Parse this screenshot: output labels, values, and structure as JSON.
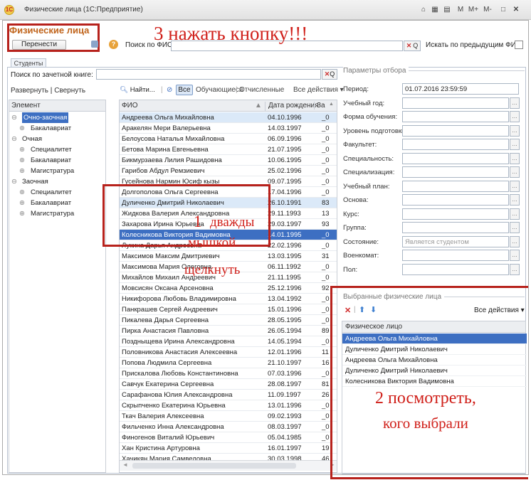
{
  "window": {
    "title": "Физические лица (1С:Предприятие)",
    "app_badge": "1С",
    "right_controls": [
      "M",
      "M+",
      "M-"
    ]
  },
  "form": {
    "title": "Физические лица",
    "move_button": "Перенести",
    "help": "?",
    "search_fio_label": "Поиск по ФИО:",
    "search_prev_label": "Искать по предыдущим ФИО:",
    "tab": "Студенты"
  },
  "left": {
    "search_label": "Поиск по зачетной книге:",
    "expand": "Развернуть",
    "sep": "|",
    "collapse": "Свернуть",
    "tree_header": "Элемент",
    "tree": [
      {
        "label": "Очно-заочная",
        "level": 0,
        "selected": true
      },
      {
        "label": "Бакалавриат",
        "level": 1
      },
      {
        "label": "Очная",
        "level": 0
      },
      {
        "label": "Специалитет",
        "level": 1
      },
      {
        "label": "Бакалавриат",
        "level": 1
      },
      {
        "label": "Магистратура",
        "level": 1
      },
      {
        "label": "Заочная",
        "level": 0
      },
      {
        "label": "Специалитет",
        "level": 1
      },
      {
        "label": "Бакалавриат",
        "level": 1
      },
      {
        "label": "Магистратура",
        "level": 1
      }
    ]
  },
  "list": {
    "find": "Найти...",
    "filter_all": "Все",
    "filter_students": "Обучающиеся",
    "filter_expelled": "Отчисленные",
    "all_actions": "Все действия",
    "col_fio": "ФИО",
    "col_birth": "Дата рождения",
    "col_extra": "За",
    "rows": [
      {
        "fio": "Андреева Ольга Михайловна",
        "date": "04.10.1996",
        "extra": "_0",
        "hl": true
      },
      {
        "fio": "Аракелян Мери Валерьевна",
        "date": "14.03.1997",
        "extra": "_0"
      },
      {
        "fio": "Белоусова Наталья Михайловна",
        "date": "06.09.1996",
        "extra": "_0"
      },
      {
        "fio": "Бетова Марина Евгеньевна",
        "date": "21.07.1995",
        "extra": "_0"
      },
      {
        "fio": "Бикмурзаева Лилия Рашидовна",
        "date": "10.06.1995",
        "extra": "_0"
      },
      {
        "fio": "Гарибов Абдул Ремзиевич",
        "date": "25.02.1996",
        "extra": "_0"
      },
      {
        "fio": "Гусейнова Нармин Юсиф кызы",
        "date": "09.07.1995",
        "extra": "_0"
      },
      {
        "fio": "Долгополова Ольга Сергеевна",
        "date": "17.04.1996",
        "extra": "_0"
      },
      {
        "fio": "Дуличенко Дмитрий Николаевич",
        "date": "26.10.1991",
        "extra": "83",
        "hl": true
      },
      {
        "fio": "Жидкова Валерия Александровна",
        "date": "29.11.1993",
        "extra": "13"
      },
      {
        "fio": "Захарова Ирина Юрьевна",
        "date": "29.03.1997",
        "extra": "93"
      },
      {
        "fio": "Колесникова Виктория Вадимовна",
        "date": "14.01.1995",
        "extra": "_0",
        "sel": true
      },
      {
        "fio": "Лукина Дарья Андреевна",
        "date": "22.02.1996",
        "extra": "_0"
      },
      {
        "fio": "Максимов Максим Дмитриевич",
        "date": "13.03.1995",
        "extra": "31"
      },
      {
        "fio": "Максимова Мария Олеговна",
        "date": "06.11.1992",
        "extra": "_0"
      },
      {
        "fio": "Михайлов Михаил Андреевич",
        "date": "21.11.1995",
        "extra": "_0"
      },
      {
        "fio": "Мовсисян Оксана Арсеновна",
        "date": "25.12.1996",
        "extra": "92"
      },
      {
        "fio": "Никифорова Любовь Владимировна",
        "date": "13.04.1992",
        "extra": "_0"
      },
      {
        "fio": "Панкрашев Сергей Андреевич",
        "date": "15.01.1996",
        "extra": "_0"
      },
      {
        "fio": "Пикалева Дарья Сергеевна",
        "date": "28.05.1995",
        "extra": "_0"
      },
      {
        "fio": "Пирка Анастасия Павловна",
        "date": "26.05.1994",
        "extra": "89"
      },
      {
        "fio": "Поздныщева Ирина Александровна",
        "date": "14.05.1994",
        "extra": "_0"
      },
      {
        "fio": "Половникова Анастасия Алексеевна",
        "date": "12.01.1996",
        "extra": "11"
      },
      {
        "fio": "Попова Людмила Сергеевна",
        "date": "21.10.1997",
        "extra": "16"
      },
      {
        "fio": "Прискалова Любовь Константиновна",
        "date": "07.03.1996",
        "extra": "_0"
      },
      {
        "fio": "Савчук Екатерина Сергеевна",
        "date": "28.08.1997",
        "extra": "81"
      },
      {
        "fio": "Сарафанова Юлия Александровна",
        "date": "11.09.1997",
        "extra": "26"
      },
      {
        "fio": "Скрыпченко Екатерина Юрьевна",
        "date": "13.01.1996",
        "extra": "_0"
      },
      {
        "fio": "Ткач Валерия Алексеевна",
        "date": "09.02.1993",
        "extra": "_0"
      },
      {
        "fio": "Фильченко Инна Александровна",
        "date": "08.03.1997",
        "extra": "_0"
      },
      {
        "fio": "Финогенов Виталий Юрьевич",
        "date": "05.04.1985",
        "extra": "_0"
      },
      {
        "fio": "Хан Кристина Артуровна",
        "date": "16.01.1997",
        "extra": "19"
      },
      {
        "fio": "Хачикян Мария Самвеловна",
        "date": "30.03.1998",
        "extra": "46"
      }
    ]
  },
  "params": {
    "group": "Параметры отбора",
    "fields": [
      {
        "label": "Период:",
        "value": "01.07.2016 23:59:59",
        "btn": false
      },
      {
        "label": "Учебный год:",
        "value": "",
        "btn": true
      },
      {
        "label": "Форма обучения:",
        "value": "",
        "btn": true
      },
      {
        "label": "Уровень подготовки:",
        "value": "",
        "btn": true
      },
      {
        "label": "Факультет:",
        "value": "",
        "btn": true
      },
      {
        "label": "Специальность:",
        "value": "",
        "btn": true
      },
      {
        "label": "Специализация:",
        "value": "",
        "btn": true
      },
      {
        "label": "Учебный план:",
        "value": "",
        "btn": true
      },
      {
        "label": "Основа:",
        "value": "",
        "btn": true
      },
      {
        "label": "Курс:",
        "value": "",
        "btn": true
      },
      {
        "label": "Группа:",
        "value": "",
        "btn": true
      },
      {
        "label": "Состояние:",
        "value": "Является студентом",
        "btn": true
      },
      {
        "label": "Военкомат:",
        "value": "",
        "btn": true
      },
      {
        "label": "Пол:",
        "value": "",
        "btn": true
      }
    ]
  },
  "selected": {
    "group": "Выбранные физические лица",
    "all_actions": "Все действия",
    "header": "Физическое лицо",
    "rows": [
      "Андреева Ольга Михайловна",
      "Дуличенко Дмитрий Николаевич",
      "Андреева Ольга Михайловна",
      "Дуличенко Дмитрий Николаевич",
      "Колесникова Виктория Вадимовна"
    ]
  },
  "annotations": {
    "step3": "3 нажать кнопку!!!",
    "step1_num": "1",
    "step1_a": "дважды",
    "step1_b": "мышкой",
    "step1_c": "щелкнуть",
    "step2_a": "2 посмотреть,",
    "step2_b": "кого выбрали"
  },
  "colors": {
    "selection": "#dbe9f8",
    "current": "#3d6fc2",
    "annotation": "#d0201a",
    "form_title": "#c0641b"
  }
}
